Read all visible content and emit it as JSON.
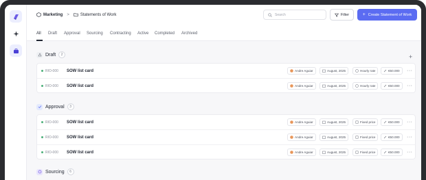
{
  "breadcrumb": {
    "workspace": "Marketing",
    "separator": ">",
    "page": "Statements of Work"
  },
  "search": {
    "placeholder": "Search"
  },
  "toolbar": {
    "filter_label": "Filter",
    "create_label": "Create Statement of Work"
  },
  "tabs": [
    {
      "label": "All"
    },
    {
      "label": "Draft"
    },
    {
      "label": "Approval"
    },
    {
      "label": "Sourcing"
    },
    {
      "label": "Contracting"
    },
    {
      "label": "Active"
    },
    {
      "label": "Completed"
    },
    {
      "label": "Archived"
    }
  ],
  "sections": {
    "draft": {
      "title": "Draft",
      "count": "2",
      "rows": [
        {
          "id": "RIO-000",
          "title": "SOW list card",
          "owner": "Andre Aguiar",
          "date": "August, 2025",
          "rate": "Hourly rate",
          "amount": "€50.000",
          "more": "···"
        },
        {
          "id": "RIO-000",
          "title": "SOW list card",
          "owner": "Andre Aguiar",
          "date": "August, 2025",
          "rate": "Hourly rate",
          "amount": "€50.000",
          "more": "···"
        }
      ]
    },
    "approval": {
      "title": "Approval",
      "count": "3",
      "rows": [
        {
          "id": "RIO-000",
          "title": "SOW list card",
          "owner": "Andre Aguiar",
          "date": "August, 2025",
          "rate": "Fixed price",
          "amount": "€50.000",
          "more": "···"
        },
        {
          "id": "RIO-000",
          "title": "SOW list card",
          "owner": "Andre Aguiar",
          "date": "August, 2025",
          "rate": "Fixed price",
          "amount": "€50.000",
          "more": "···"
        },
        {
          "id": "RIO-000",
          "title": "SOW list card",
          "owner": "Andre Aguiar",
          "date": "August, 2025",
          "rate": "Fixed price",
          "amount": "€50.000",
          "more": "···"
        }
      ]
    },
    "sourcing": {
      "title": "Sourcing",
      "count": "6"
    }
  },
  "colors": {
    "accent": "#5b6cf2",
    "status_dot": "#4db07a"
  },
  "icons": {
    "rail": [
      "app-logo-icon",
      "sparkle-icon",
      "briefcase-icon"
    ],
    "chips": [
      "avatar",
      "calendar-icon",
      "clock-icon",
      "link-icon"
    ]
  }
}
